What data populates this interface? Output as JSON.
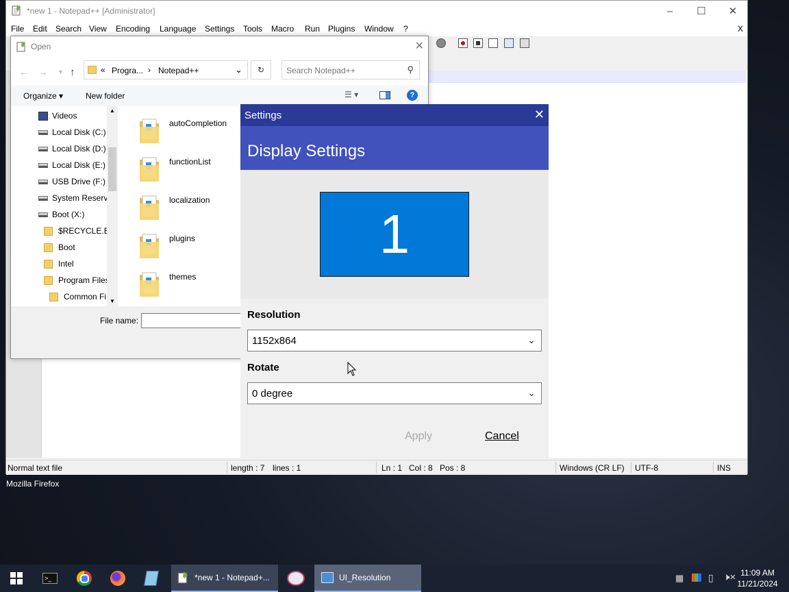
{
  "desktop": {
    "label": "Mozilla Firefox"
  },
  "npp": {
    "title": "*new 1 - Notepad++ [Administrator]",
    "menu": [
      "File",
      "Edit",
      "Search",
      "View",
      "Encoding",
      "Language",
      "Settings",
      "Tools",
      "Macro",
      "Run",
      "Plugins",
      "Window",
      "?"
    ],
    "menu_close": "X",
    "status": {
      "type": "Normal text file",
      "length": "length : 7",
      "lines": "lines : 1",
      "ln": "Ln : 1",
      "col": "Col : 8",
      "pos": "Pos : 8",
      "eol": "Windows (CR LF)",
      "encoding": "UTF-8",
      "mode": "INS"
    }
  },
  "open_dialog": {
    "title": "Open",
    "path": {
      "prefix": "«",
      "crumb1": "Progra...",
      "sep": "›",
      "crumb2": "Notepad++"
    },
    "search_placeholder": "Search Notepad++",
    "organize": "Organize",
    "new_folder": "New folder",
    "tree": [
      {
        "label": "Videos",
        "icon": "video-icon",
        "indent": 0
      },
      {
        "label": "Local Disk (C:)",
        "icon": "drive-icon",
        "indent": 0
      },
      {
        "label": "Local Disk (D:)",
        "icon": "drive-icon",
        "indent": 0
      },
      {
        "label": "Local Disk (E:)",
        "icon": "drive-icon",
        "indent": 0
      },
      {
        "label": "USB Drive (F:)",
        "icon": "drive-icon",
        "indent": 0
      },
      {
        "label": "System Reserve",
        "icon": "drive-icon",
        "indent": 0
      },
      {
        "label": "Boot (X:)",
        "icon": "drive-icon",
        "indent": 0
      },
      {
        "label": "$RECYCLE.BIN",
        "icon": "folder-icon",
        "indent": 1
      },
      {
        "label": "Boot",
        "icon": "folder-icon",
        "indent": 1
      },
      {
        "label": "Intel",
        "icon": "folder-icon",
        "indent": 1
      },
      {
        "label": "Program Files",
        "icon": "folder-icon",
        "indent": 1
      },
      {
        "label": "Common Fi",
        "icon": "folder-icon",
        "indent": 2
      }
    ],
    "files": [
      "autoCompletion",
      "functionList",
      "localization",
      "plugins",
      "themes"
    ],
    "filename_label": "File name:"
  },
  "settings": {
    "title": "Settings",
    "heading": "Display Settings",
    "monitor_number": "1",
    "resolution_label": "Resolution",
    "resolution_value": "1152x864",
    "rotate_label": "Rotate",
    "rotate_value": "0 degree",
    "apply": "Apply",
    "cancel": "Cancel",
    "colors": {
      "titlebar": "#2b3a97",
      "header": "#4152bd",
      "monitor": "#0078d7"
    }
  },
  "taskbar": {
    "tasks": [
      {
        "label": "*new 1 - Notepad+..."
      },
      {
        "label": "UI_Resolution"
      }
    ],
    "time": "11:09 AM",
    "date": "11/21/2024"
  }
}
